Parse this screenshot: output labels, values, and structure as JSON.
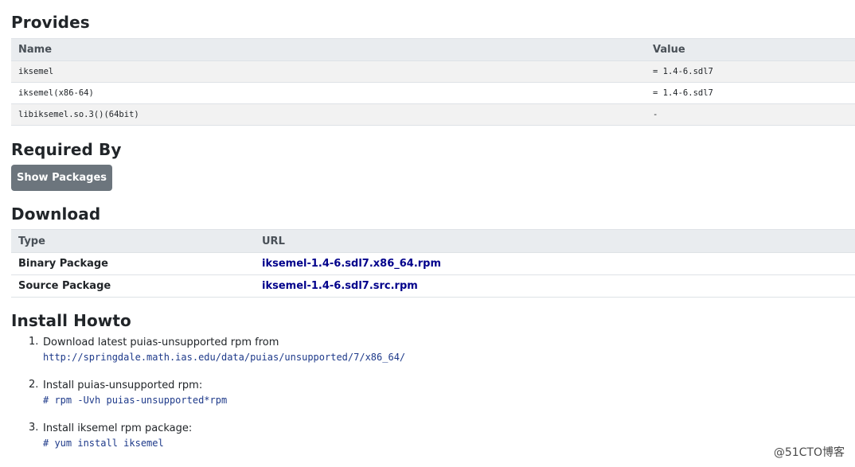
{
  "provides": {
    "title": "Provides",
    "columns": [
      "Name",
      "Value"
    ],
    "rows": [
      {
        "name": "iksemel",
        "value": "= 1.4-6.sdl7"
      },
      {
        "name": "iksemel(x86-64)",
        "value": "= 1.4-6.sdl7"
      },
      {
        "name": "libiksemel.so.3()(64bit)",
        "value": "-"
      }
    ]
  },
  "required_by": {
    "title": "Required By",
    "button_label": "Show Packages"
  },
  "download": {
    "title": "Download",
    "columns": [
      "Type",
      "URL"
    ],
    "rows": [
      {
        "type": "Binary Package",
        "url": "iksemel-1.4-6.sdl7.x86_64.rpm"
      },
      {
        "type": "Source Package",
        "url": "iksemel-1.4-6.sdl7.src.rpm"
      }
    ]
  },
  "howto": {
    "title": "Install Howto",
    "steps": [
      {
        "num": "1.",
        "text": "Download latest puias-unsupported rpm from",
        "code": "http://springdale.math.ias.edu/data/puias/unsupported/7/x86_64/"
      },
      {
        "num": "2.",
        "text": "Install puias-unsupported rpm:",
        "code": "# rpm -Uvh puias-unsupported*rpm"
      },
      {
        "num": "3.",
        "text": "Install iksemel rpm package:",
        "code": "# yum install iksemel"
      }
    ]
  },
  "watermark": "@51CTO博客",
  "colors": {
    "header_bg": "#e9ecef",
    "button_bg": "#6c757d",
    "link": "#00008b"
  }
}
